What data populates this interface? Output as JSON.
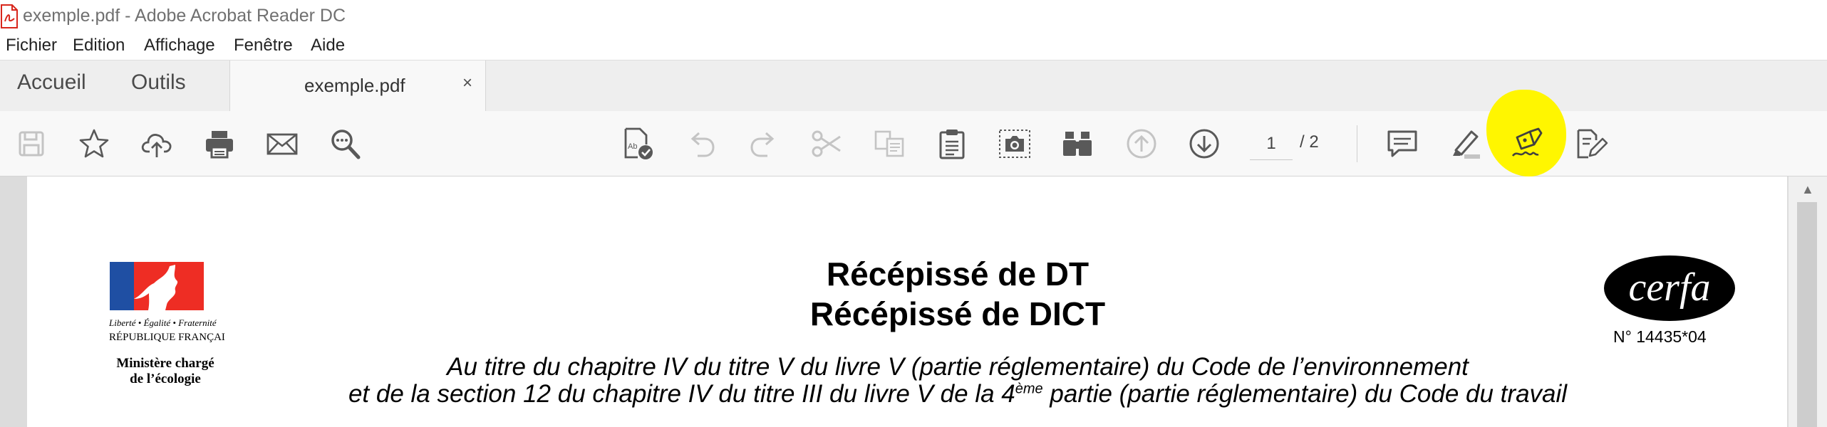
{
  "window": {
    "title": "exemple.pdf - Adobe Acrobat Reader DC"
  },
  "menu": {
    "items": [
      "Fichier",
      "Edition",
      "Affichage",
      "Fenêtre",
      "Aide"
    ]
  },
  "tabs": {
    "home": "Accueil",
    "tools": "Outils",
    "document": "exemple.pdf",
    "close_symbol": "×"
  },
  "toolbar": {
    "buttons": [
      "save",
      "bookmark",
      "upload",
      "print",
      "email",
      "search",
      "edit-pdf-text",
      "undo",
      "redo",
      "cut",
      "copy",
      "paste",
      "snapshot",
      "compare",
      "previous-page",
      "next-page",
      "comment",
      "highlight",
      "sign",
      "fill-and-sign"
    ],
    "page_current": "1",
    "page_total": "/ 2",
    "sign_highlight_color": "#fff600"
  },
  "document": {
    "logo": {
      "liberte": "Liberté • Égalité • Fraternité",
      "republique": "RÉPUBLIQUE FRANÇAISE",
      "ministere_line1": "Ministère chargé",
      "ministere_line2": "de l’écologie"
    },
    "title_line1": "Récépissé de DT",
    "title_line2": "Récépissé de DICT",
    "subtitle_line1": "Au titre du chapitre IV du titre V du livre V (partie réglementaire) du Code de l’environnement",
    "subtitle_line2_before": "et de la section 12 du chapitre IV du titre III du livre V de la 4",
    "subtitle_line2_sup": "ème",
    "subtitle_line2_after": " partie (partie réglementaire) du Code du travail",
    "cerfa_word": "cerfa",
    "cerfa_number": "N° 14435*04"
  },
  "colors": {
    "flag_blue": "#1f4fa3",
    "flag_red": "#ee2d24",
    "icon_gray": "#595959",
    "icon_disabled": "#c4c4c4",
    "pdf_red": "#d8261c"
  }
}
